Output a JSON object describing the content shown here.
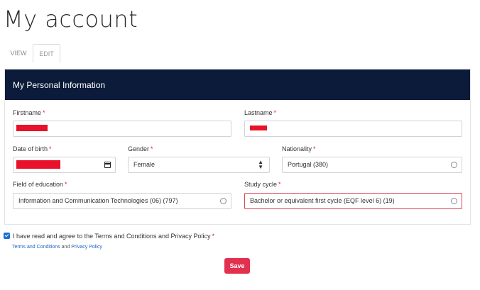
{
  "page": {
    "title": "My account"
  },
  "tabs": [
    {
      "label": "VIEW",
      "active": false
    },
    {
      "label": "EDIT",
      "active": true
    }
  ],
  "card": {
    "header": "My Personal Information"
  },
  "form": {
    "firstname": {
      "label": "Firstname",
      "required_mark": "*",
      "value_redacted": true
    },
    "lastname": {
      "label": "Lastname",
      "required_mark": "*",
      "value_redacted": true
    },
    "date_of_birth": {
      "label": "Date of birth",
      "required_mark": "*",
      "value_redacted": true,
      "icon": "calendar-icon"
    },
    "gender": {
      "label": "Gender",
      "required_mark": "*",
      "value": "Female",
      "icon": "sort-icon"
    },
    "nationality": {
      "label": "Nationality",
      "required_mark": "*",
      "value": "Portugal (380)",
      "icon": "ring-icon"
    },
    "field_of_education": {
      "label": "Field of education",
      "required_mark": "*",
      "value": "Information and Communication Technologies (06) (797)",
      "icon": "ring-icon"
    },
    "study_cycle": {
      "label": "Study cycle",
      "required_mark": "*",
      "value": "Bachelor or equivalent first cycle (EQF level 6) (19)",
      "icon": "ring-icon",
      "invalid": true
    }
  },
  "agreement": {
    "checked": true,
    "text": "I have read and agree to the Terms and Conditions and Privacy Policy",
    "required_mark": "*",
    "terms_link": "Terms and Conditions",
    "and_text": "and",
    "privacy_link": "Privacy Policy"
  },
  "actions": {
    "save_label": "Save"
  },
  "colors": {
    "header_bg": "#0c1b3a",
    "required": "#d9232e",
    "save_button": "#e2304f",
    "link": "#1a63c7",
    "redaction": "#e8122a"
  }
}
